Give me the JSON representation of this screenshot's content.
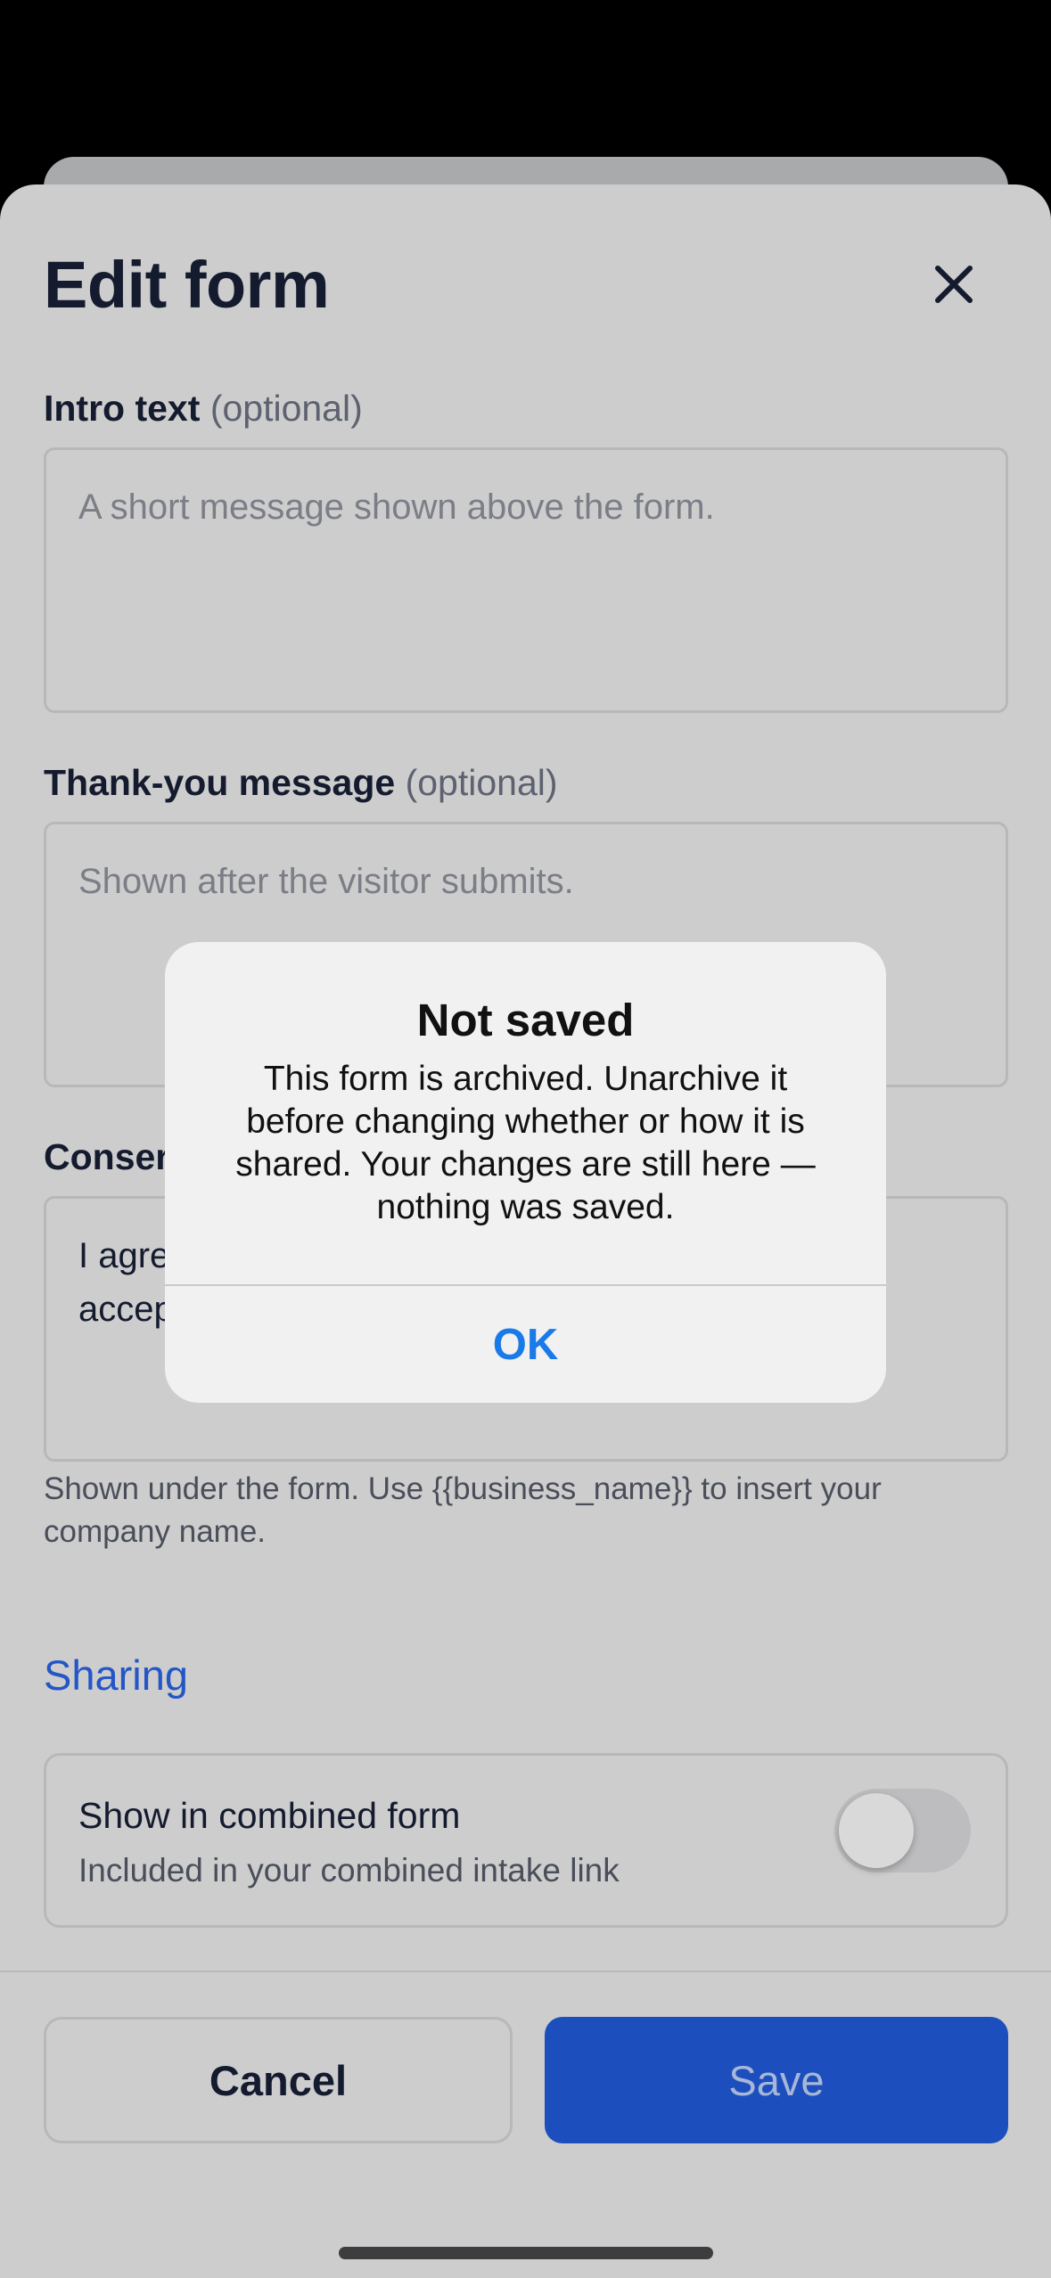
{
  "sheet": {
    "title": "Edit form"
  },
  "intro": {
    "label": "Intro text",
    "optional": "(optional)",
    "placeholder": "A short message shown above the form."
  },
  "thank_you": {
    "label": "Thank-you message",
    "optional": "(optional)",
    "placeholder": "Shown after the visitor submits."
  },
  "consent": {
    "label_visible": "Conser",
    "value_line1": "I agre",
    "value_line2": "accep",
    "hint": "Shown under the form. Use {{business_name}} to insert your company name."
  },
  "sharing": {
    "section_title": "Sharing",
    "combined_title": "Show in combined form",
    "combined_subtitle": "Included in your combined intake link",
    "combined_enabled": false
  },
  "footer": {
    "cancel_label": "Cancel",
    "save_label": "Save"
  },
  "alert": {
    "title": "Not saved",
    "message": "This form is archived. Unarchive it before changing whether or how it is shared. Your changes are still here — nothing was saved.",
    "ok_label": "OK"
  },
  "colors": {
    "accent": "#2456c6",
    "primary_button": "#1c4fbd",
    "alert_action": "#1a7ae8"
  }
}
